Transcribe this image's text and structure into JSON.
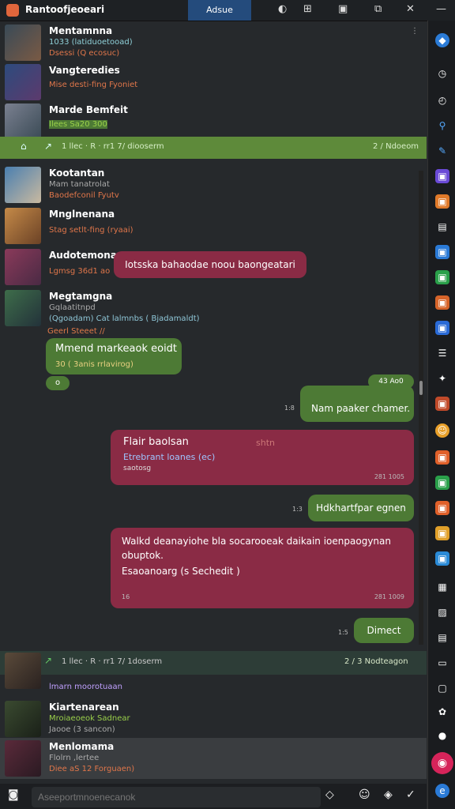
{
  "app": {
    "title": "Rantoofjeoeari",
    "center_tab": "Adsue"
  },
  "colors": {
    "accent": "#5e8a3a",
    "bubble_red": "#8a2b45",
    "bubble_green": "#4d7a35"
  },
  "contacts_top": [
    {
      "name": "Mentamnna",
      "line1": "1033 (latiduoetooad)",
      "line2": "Dsessi (Q ecosuc)"
    },
    {
      "name": "Vangteredies",
      "line2": "Mise desti-fing  Fyoniet"
    },
    {
      "name": "Marde Bemfeit",
      "line2": "Ilees  Sa20 300"
    }
  ],
  "group_bar_1": {
    "left": "1 llec  ·  R  ·  rr1 7/ diooserm",
    "right": "2 / Ndoeom"
  },
  "contacts_mid": [
    {
      "name": "Kootantan",
      "line1": "Mam tanatrolat",
      "line2": "Baodefconil  Fyutv"
    },
    {
      "name": "Mnglnenana",
      "line2": "Stag setlt-fing  (ryaai)"
    },
    {
      "name": "Audotemonar",
      "line2": "Lgmsg 36d1  ao"
    },
    {
      "name": "Megtamgna",
      "line1": "Gqlaatitnpd",
      "line2": "(Qgoadam)  Cat lalmnbs  ( Bjadamaldt)"
    }
  ],
  "messages": {
    "thread_label": "Geerl  Steeet //",
    "red_popup": "Iotsska bahaodae noou baongeatari",
    "green1": {
      "text": "Mmend markeaok eoidt",
      "sub": "30  ( 3anis rrlavirog)",
      "tiny": "o"
    },
    "green2": {
      "time_top": "43 Ao0",
      "side_time": "1:8",
      "text": "Nam paaker chamer."
    },
    "red2": {
      "text": "Flair baolsan",
      "text_faded": "shtn",
      "sub": "Etrebrant loanes (ec)",
      "sub2": "saotosg",
      "time": "281 1005"
    },
    "green3": {
      "side_time": "1:3",
      "text": "Hdkhartfpar egnen"
    },
    "red3": {
      "line1": "Walkd deanayiohe bla  socarooeak  daikain  ioenpaogynan",
      "line2": "obuptok.",
      "line3": "Esaoanoarg (s Sechedit )",
      "time_left": "16",
      "time": "281 1009"
    },
    "green4": {
      "side_time": "1:5",
      "text": "Dimect"
    }
  },
  "group_bar_2": {
    "left": "1 llec  ·  R  ·  rr1 7/ 1doserm",
    "right": "2 / 3 Nodteagon"
  },
  "contacts_bottom": [
    {
      "line2": "lmarn moorotuaan"
    },
    {
      "name": "Kiartenarean",
      "line1": "Mroiaeoeok  Sadnear",
      "line2": "Jaooe  (3 sancon)"
    },
    {
      "name": "Menlomama",
      "line1": "Flolrn ,lertee",
      "line2": "Diee  aS  12  Forguaen)"
    }
  ],
  "input": {
    "placeholder": "Aseeportmnoenecanok"
  }
}
